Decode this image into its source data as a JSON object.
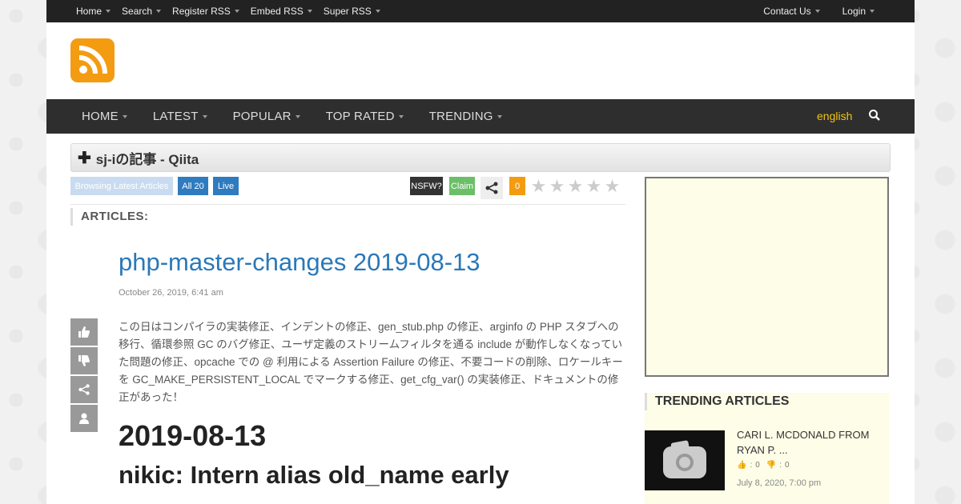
{
  "topbar": {
    "left_items": [
      "Home",
      "Search",
      "Register RSS",
      "Embed RSS",
      "Super RSS"
    ],
    "right_items": [
      "Contact Us",
      "Login"
    ]
  },
  "mainnav": {
    "items": [
      "HOME",
      "LATEST",
      "POPULAR",
      "TOP RATED",
      "TRENDING"
    ],
    "language": "english"
  },
  "feed": {
    "title": "sj-iの記事 - Qiita"
  },
  "toolbar": {
    "browsing_label": "Browsing Latest Articles",
    "all_label": "All 20",
    "live_label": "Live",
    "nsfw_label": "NSFW?",
    "claim_label": "Claim",
    "vote_count": "0",
    "rating_stars": 5
  },
  "articles": {
    "heading": "ARTICLES:",
    "title": "php-master-changes 2019-08-13",
    "date": "October 26, 2019, 6:41 am",
    "body": "この日はコンパイラの実装修正、インデントの修正、gen_stub.php の修正、arginfo の PHP スタブへの移行、循環参照 GC のバグ修正、ユーザ定義のストリームフィルタを通る include が動作しなくなっていた問題の修正、opcache での @ 利用による Assertion Failure の修正、不要コードの削除、ロケールキーを GC_MAKE_PERSISTENT_LOCAL でマークする修正、get_cfg_var() の実装修正、ドキュメントの修正があった！",
    "h2": "2019-08-13",
    "h3": "nikic: Intern alias old_name early"
  },
  "sidebar": {
    "trending_heading": "TRENDING ARTICLES",
    "trending": {
      "title": "CARI L. MCDONALD FROM RYAN P. ...",
      "likes": "0",
      "dislikes": "0",
      "date": "July 8, 2020, 7:00 pm"
    }
  },
  "colors": {
    "accent": "#2a78b8",
    "rss_orange": "#f39c12",
    "nav_bg": "#2e2e2e",
    "topbar_bg": "#222222"
  }
}
